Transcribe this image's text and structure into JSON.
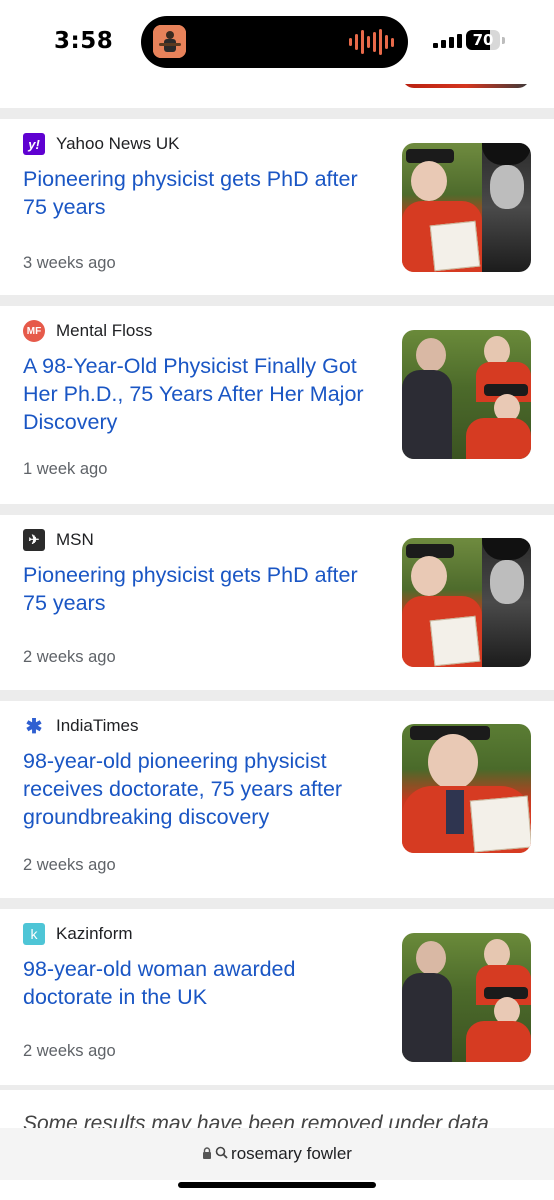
{
  "status_bar": {
    "time": "3:58",
    "battery": "70",
    "battery_level": 0.7
  },
  "articles": [
    {
      "source": "Yahoo News UK",
      "logo_text": "y!",
      "headline": "Pioneering physicist gets PhD after 75 years",
      "time_ago": "3 weeks ago"
    },
    {
      "source": "Mental Floss",
      "logo_text": "MF",
      "headline": "A 98-Year-Old Physicist Finally Got Her Ph.D., 75 Years After Her Major Discovery",
      "time_ago": "1 week ago"
    },
    {
      "source": "MSN",
      "logo_text": "✈",
      "headline": "Pioneering physicist gets PhD after 75 years",
      "time_ago": "2 weeks ago"
    },
    {
      "source": "IndiaTimes",
      "logo_text": "✱",
      "headline": "98-year-old pioneering physicist receives doctorate, 75 years after groundbreaking discovery",
      "time_ago": "2 weeks ago"
    },
    {
      "source": "Kazinform",
      "logo_text": "k",
      "headline": "98-year-old woman awarded doctorate in the UK",
      "time_ago": "2 weeks ago"
    }
  ],
  "notice": "Some results may have been removed under data",
  "url_bar": {
    "query": "rosemary fowler"
  }
}
